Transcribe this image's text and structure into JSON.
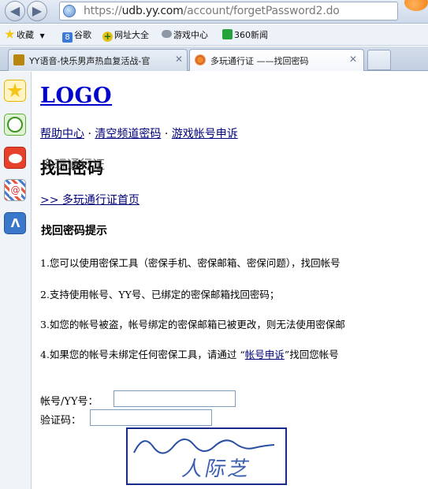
{
  "browser": {
    "url_prefix": "https://",
    "url_host": "udb.yy.com",
    "url_path": "/account/forgetPassword2.do",
    "favorites": [
      {
        "label": "收藏",
        "icon": "star-icon"
      },
      {
        "label": "谷歌",
        "icon": "google-icon"
      },
      {
        "label": "网址大全",
        "icon": "plus-icon"
      },
      {
        "label": "游戏中心",
        "icon": "gamepad-icon"
      },
      {
        "label": "360新闻",
        "icon": "search-icon"
      }
    ],
    "tabs": [
      {
        "label": "YY语音-快乐男声热血复活战-官",
        "active": false
      },
      {
        "label": "多玩通行证 ——找回密码",
        "active": true
      }
    ],
    "sidebar": [
      "favorites-star-icon",
      "history-clock-icon",
      "weibo-icon",
      "email-icon",
      "chat-icon"
    ]
  },
  "page": {
    "logo": "LOGO",
    "top_links": [
      "帮助中心",
      "清空频道密码",
      "游戏帐号申诉"
    ],
    "separator": "·",
    "title_main": "找回密码",
    "title_overlay": "多玩通行证",
    "home_link": ">> 多玩通行证首页",
    "hint_title": "找回密码提示",
    "hints": [
      "1.您可以使用密保工具（密保手机、密保邮箱、密保问题），找回帐号",
      "2.支持使用帐号、YY号、已绑定的密保邮箱找回密码；",
      "3.如您的帐号被盗，帐号绑定的密保邮箱已被更改，则无法使用密保邮"
    ],
    "hint4_before": "4.如果您的帐号未绑定任何密保工具，请通过 “",
    "hint4_link": "帐号申诉",
    "hint4_after": "”找回您帐号",
    "form": {
      "account_label": "帐号/YY号：",
      "account_value": "",
      "captcha_label": "验证码：",
      "captcha_value": "",
      "captcha_text": "人际芝"
    }
  },
  "colors": {
    "link": "#00007a",
    "logo": "#0000cc",
    "captcha_border": "#1a2a8a"
  }
}
